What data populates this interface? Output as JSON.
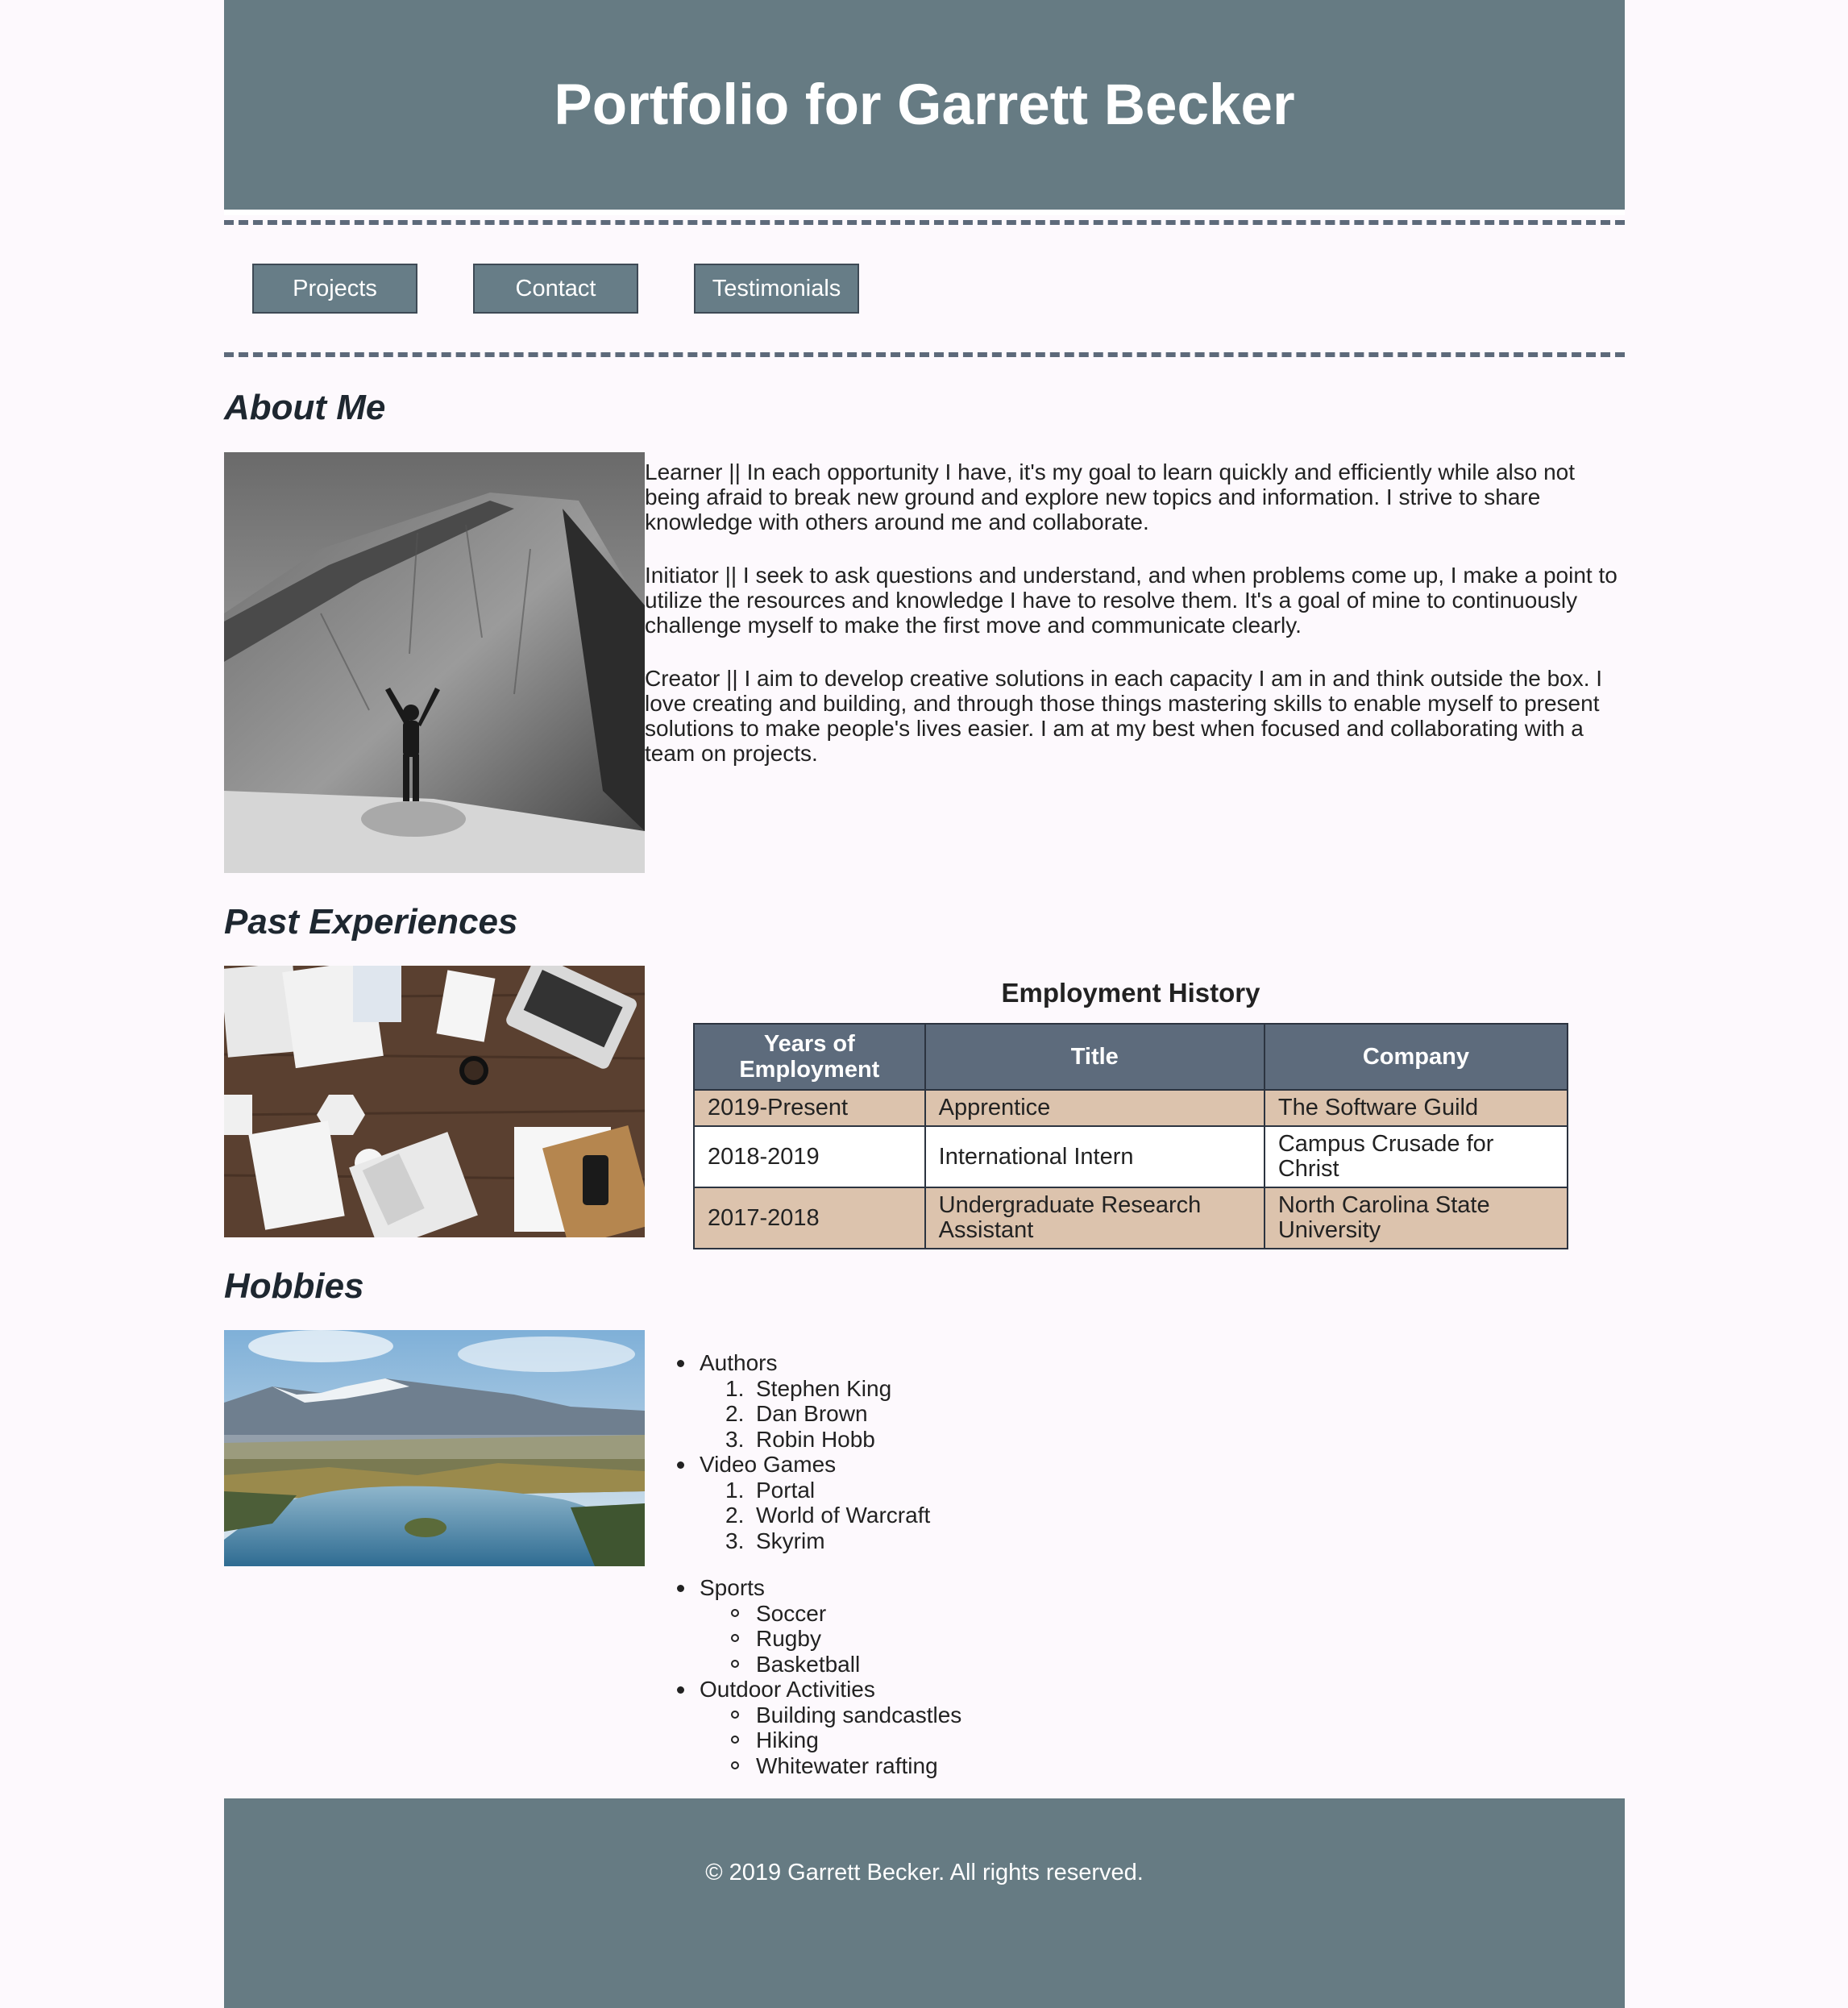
{
  "header": {
    "title": "Portfolio for Garrett Becker"
  },
  "nav": {
    "items": [
      "Projects",
      "Contact",
      "Testimonials"
    ]
  },
  "about": {
    "heading": "About Me",
    "paragraphs": [
      "Learner || In each opportunity I have, it's my goal to learn quickly and efficiently while also not being afraid to break new ground and explore new topics and information. I strive to share knowledge with others around me and collaborate.",
      "Initiator || I seek to ask questions and understand, and when problems come up, I make a point to utilize the resources and knowledge I have to resolve them. It's a goal of mine to continuously challenge myself to make the first move and communicate clearly.",
      "Creator || I aim to develop creative solutions in each capacity I am in and think outside the box. I love creating and building, and through those things mastering skills to enable myself to present solutions to make people's lives easier. I am at my best when focused and collaborating with a team on projects."
    ]
  },
  "experience": {
    "heading": "Past Experiences",
    "table_caption": "Employment History",
    "columns": [
      "Years of Employment",
      "Title",
      "Company"
    ],
    "rows": [
      [
        "2019-Present",
        "Apprentice",
        "The Software Guild"
      ],
      [
        "2018-2019",
        "International Intern",
        "Campus Crusade for Christ"
      ],
      [
        "2017-2018",
        "Undergraduate Research Assistant",
        "North Carolina State University"
      ]
    ]
  },
  "hobbies": {
    "heading": "Hobbies",
    "authors_label": "Authors",
    "authors": [
      "Stephen King",
      "Dan Brown",
      "Robin Hobb"
    ],
    "games_label": "Video Games",
    "games": [
      "Portal",
      "World of Warcraft",
      "Skyrim"
    ],
    "sports_label": "Sports",
    "sports": [
      "Soccer",
      "Rugby",
      "Basketball"
    ],
    "outdoor_label": "Outdoor Activities",
    "outdoor": [
      "Building sandcastles",
      "Hiking",
      "Whitewater rafting"
    ]
  },
  "footer": {
    "text": "© 2019 Garrett Becker. All rights reserved."
  },
  "colors": {
    "header_bg": "#667b83",
    "page_bg": "#fdf9fd",
    "table_header_bg": "#5d6b7c",
    "table_row_tan": "#dcc3ad"
  }
}
